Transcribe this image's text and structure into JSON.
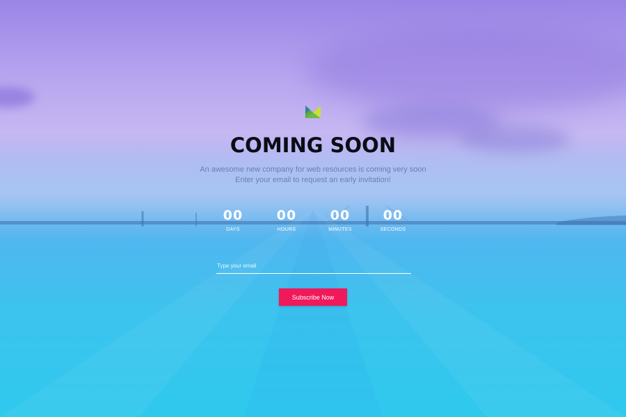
{
  "page": {
    "title": "COMING SOON",
    "subtitle_line1": "An awesome new company for web resources is coming very soon",
    "subtitle_line2": "Enter your email to request an early invitation!"
  },
  "logo": {
    "icon": "brand-m-logo-icon",
    "colors": [
      "#2e8b3d",
      "#8fd23a",
      "#c9e03a"
    ]
  },
  "countdown": {
    "items": [
      {
        "value": "00",
        "label": "DAYS"
      },
      {
        "value": "00",
        "label": "HOURS"
      },
      {
        "value": "00",
        "label": "MINUTES"
      },
      {
        "value": "00",
        "label": "SECONDS"
      }
    ]
  },
  "form": {
    "email_placeholder": "Type your email",
    "email_value": "",
    "subscribe_label": "Subscribe Now"
  },
  "colors": {
    "accent": "#f0195a",
    "title": "#0c0c16",
    "sky_top": "#9a85e6",
    "sea": "#2fc9ee"
  }
}
